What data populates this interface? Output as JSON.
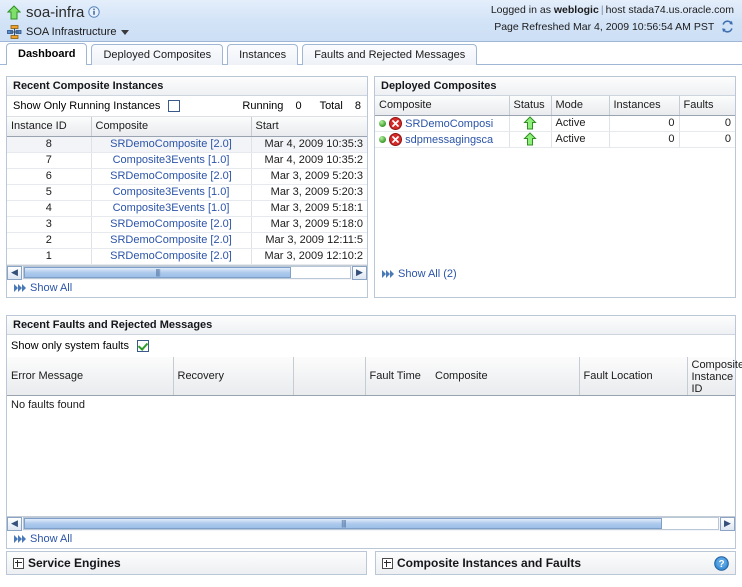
{
  "header": {
    "up_arrow_icon": "up-arrow-icon",
    "title": "soa-infra",
    "info_icon": "info-icon",
    "infra_icon": "soa-infrastructure-icon",
    "subtitle": "SOA Infrastructure",
    "menu_caret_icon": "chevron-down-icon",
    "logged_in_prefix": "Logged in as",
    "user": "weblogic",
    "host_label": "host",
    "host": "stada74.us.oracle.com",
    "page_refreshed": "Page Refreshed Mar 4, 2009 10:56:54 AM PST",
    "refresh_icon": "refresh-icon"
  },
  "tabs": [
    {
      "label": "Dashboard",
      "active": true
    },
    {
      "label": "Deployed Composites",
      "active": false
    },
    {
      "label": "Instances",
      "active": false
    },
    {
      "label": "Faults and Rejected Messages",
      "active": false
    }
  ],
  "recent_instances": {
    "panel_title": "Recent Composite Instances",
    "filter_label": "Show Only Running Instances",
    "filter_checked": false,
    "running_label": "Running",
    "running_value": "0",
    "total_label": "Total",
    "total_value": "8",
    "columns": [
      "Instance ID",
      "Composite",
      "Start"
    ],
    "rows": [
      {
        "id": "8",
        "composite": "SRDemoComposite [2.0]",
        "start": "Mar 4, 2009 10:35:3"
      },
      {
        "id": "7",
        "composite": "Composite3Events [1.0]",
        "start": "Mar 4, 2009 10:35:2"
      },
      {
        "id": "6",
        "composite": "SRDemoComposite [2.0]",
        "start": "Mar 3, 2009 5:20:3"
      },
      {
        "id": "5",
        "composite": "Composite3Events [1.0]",
        "start": "Mar 3, 2009 5:20:3"
      },
      {
        "id": "4",
        "composite": "Composite3Events [1.0]",
        "start": "Mar 3, 2009 5:18:1"
      },
      {
        "id": "3",
        "composite": "SRDemoComposite [2.0]",
        "start": "Mar 3, 2009 5:18:0"
      },
      {
        "id": "2",
        "composite": "SRDemoComposite [2.0]",
        "start": "Mar 3, 2009 12:11:5"
      },
      {
        "id": "1",
        "composite": "SRDemoComposite [2.0]",
        "start": "Mar 3, 2009 12:10:2"
      }
    ],
    "show_all_label": "Show All",
    "show_all_icon": "show-all-icon",
    "scroll_left_icon": "scroll-left-icon",
    "scroll_right_icon": "scroll-right-icon"
  },
  "deployed_composites": {
    "panel_title": "Deployed Composites",
    "columns": [
      "Composite",
      "Status",
      "Mode",
      "Instances",
      "Faults"
    ],
    "rows": [
      {
        "state_dot": "green-dot",
        "error_icon": "error-icon",
        "composite": "SRDemoComposi",
        "status_icon": "up-arrow-green-icon",
        "mode": "Active",
        "instances": "0",
        "faults": "0"
      },
      {
        "state_dot": "green-dot",
        "error_icon": "error-icon",
        "composite": "sdpmessagingsca",
        "status_icon": "up-arrow-green-icon",
        "mode": "Active",
        "instances": "0",
        "faults": "0"
      }
    ],
    "show_all_label": "Show All (2)",
    "show_all_icon": "show-all-icon"
  },
  "recent_faults": {
    "panel_title": "Recent Faults and Rejected Messages",
    "filter_label": "Show only system faults",
    "filter_checked": true,
    "columns": [
      "Error Message",
      "Recovery",
      "",
      "Fault Time",
      "Composite",
      "Fault Location",
      "Composite Instance ID"
    ],
    "empty_message": "No faults found",
    "show_all_label": "Show All",
    "show_all_icon": "show-all-icon",
    "scroll_left_icon": "scroll-left-icon",
    "scroll_right_icon": "scroll-right-icon"
  },
  "bottom_panels": [
    {
      "label": "Service Engines",
      "expander_icon": "plus-box-icon",
      "has_help": false
    },
    {
      "label": "Composite Instances and Faults",
      "expander_icon": "plus-box-icon",
      "has_help": true,
      "help_icon": "help-icon"
    }
  ],
  "colors": {
    "header_bg": "#d2e3f7",
    "link": "#2b54a8",
    "accent_border": "#9fb7d4",
    "green": "#3a9b2a",
    "error_red": "#cc2222"
  }
}
